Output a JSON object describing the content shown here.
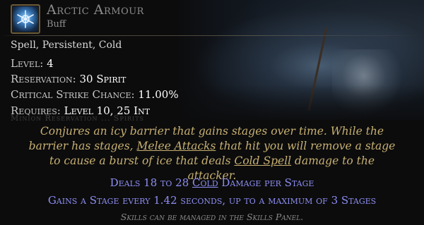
{
  "skill": {
    "name": "Arctic Armour",
    "tag": "Buff",
    "icon": "ice-armour-icon"
  },
  "keywords": "Spell, Persistent, Cold",
  "stats": {
    "level_label": "Level:",
    "level_value": "4",
    "reservation_label": "Reservation:",
    "reservation_value": "30 Spirit",
    "crit_label": "Critical Strike Chance:",
    "crit_value": "11.00%",
    "requires_label": "Requires:",
    "requires_value": "Level 10, 25 Int"
  },
  "faint_text": "Minion Reservation ... Spirits",
  "description": {
    "part1": "Conjures an icy barrier that gains stages over time. While the barrier has stages, ",
    "link1": "Melee Attacks",
    "part2": " that hit you will remove a stage to cause a burst of ice that deals ",
    "link2": "Cold Spell",
    "part3": " damage to the attacker."
  },
  "mods": {
    "mod1_pre": "Deals 18 to 28 ",
    "mod1_link": "Cold",
    "mod1_post": " Damage per Stage",
    "mod2": "Gains a Stage every 1.42 seconds, up to a maximum of 3 Stages"
  },
  "footer": "Skills can be managed in the Skills Panel.",
  "colors": {
    "description": "#c7b071",
    "mod": "#8e8ef2",
    "name": "#8c8c8c"
  }
}
